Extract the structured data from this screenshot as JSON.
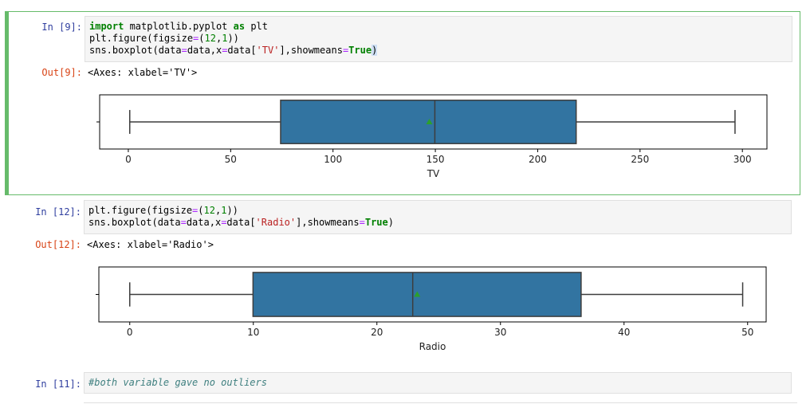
{
  "cells": [
    {
      "prompt": "In [9]:",
      "out_prompt": "Out[9]:",
      "output_text": "<Axes: xlabel='TV'>",
      "code": {
        "l1_kw1": "import",
        "l1_mod": " matplotlib.pyplot ",
        "l1_kw2": "as",
        "l1_alias": " plt",
        "l2_a": "plt.figure(figsize",
        "l2_eq": "=",
        "l2_p1": "(",
        "l2_n1": "12",
        "l2_c": ",",
        "l2_n2": "1",
        "l2_p2": "))",
        "l3_a": "sns.boxplot(data",
        "l3_eq1": "=",
        "l3_b": "data,x",
        "l3_eq2": "=",
        "l3_c": "data[",
        "l3_s": "'TV'",
        "l3_d": "],showmeans",
        "l3_eq3": "=",
        "l3_t": "True",
        "l3_e": ")"
      },
      "chart_data": {
        "type": "box",
        "xlabel": "TV",
        "xlim": [
          -14,
          312
        ],
        "ticks": [
          0,
          50,
          100,
          150,
          200,
          250,
          300
        ],
        "tick_labels": [
          "0",
          "50",
          "100",
          "150",
          "200",
          "250",
          "300"
        ],
        "whisker_low": 0.7,
        "q1": 74.4,
        "median": 149.75,
        "mean": 147.04,
        "q3": 218.8,
        "whisker_high": 296.4,
        "box_color": "#3274a1",
        "mean_color": "#2ca02c"
      }
    },
    {
      "prompt": "In [12]:",
      "out_prompt": "Out[12]:",
      "output_text": "<Axes: xlabel='Radio'>",
      "code": {
        "l1_a": "plt.figure(figsize",
        "l1_eq": "=",
        "l1_p1": "(",
        "l1_n1": "12",
        "l1_c": ",",
        "l1_n2": "1",
        "l1_p2": "))",
        "l2_a": "sns.boxplot(data",
        "l2_eq1": "=",
        "l2_b": "data,x",
        "l2_eq2": "=",
        "l2_c": "data[",
        "l2_s": "'Radio'",
        "l2_d": "],showmeans",
        "l2_eq3": "=",
        "l2_t": "True",
        "l2_e": ")"
      },
      "chart_data": {
        "type": "box",
        "xlabel": "Radio",
        "xlim": [
          -2.5,
          51.5
        ],
        "ticks": [
          0,
          10,
          20,
          30,
          40,
          50
        ],
        "tick_labels": [
          "0",
          "10",
          "20",
          "30",
          "40",
          "50"
        ],
        "whisker_low": 0.0,
        "q1": 9.975,
        "median": 22.9,
        "mean": 23.26,
        "q3": 36.525,
        "whisker_high": 49.6,
        "box_color": "#3274a1",
        "mean_color": "#2ca02c"
      }
    },
    {
      "prompt": "In [11]:",
      "comment": "#both variable gave no outliers"
    }
  ]
}
